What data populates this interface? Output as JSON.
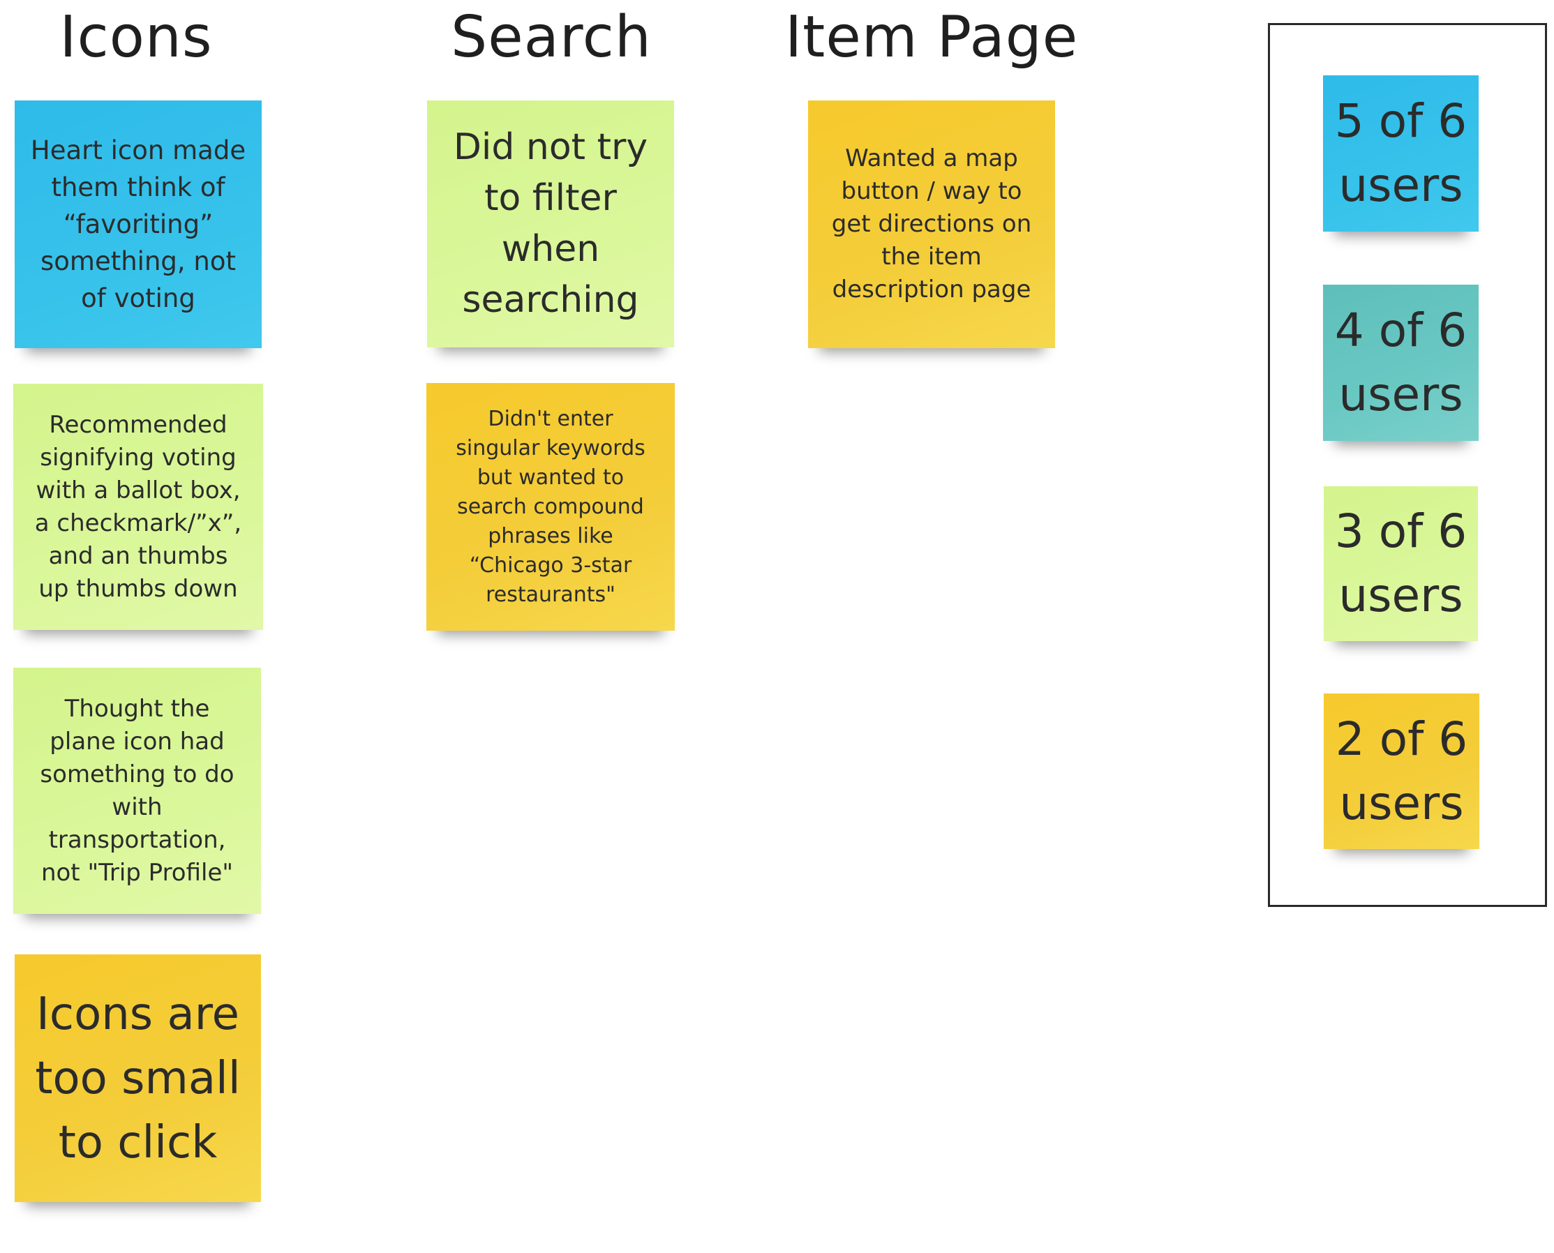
{
  "columns": [
    {
      "title": "Icons"
    },
    {
      "title": "Search"
    },
    {
      "title": "Item Page"
    }
  ],
  "notes": {
    "heart_icon": {
      "text": "Heart icon made them think of “favoriting” something, not of voting",
      "color": "blue"
    },
    "ballot_box": {
      "text": "Recommended signifying voting with a ballot box, a checkmark/”x”, and an thumbs up thumbs down",
      "color": "green"
    },
    "plane_icon": {
      "text": "Thought the plane icon had something to do with transportation, not \"Trip Profile\"",
      "color": "green"
    },
    "icons_small": {
      "text": "Icons are too small to click",
      "color": "yellow"
    },
    "no_filter": {
      "text": "Did not try to filter when searching",
      "color": "green"
    },
    "compound_phrases": {
      "text": "Didn't enter singular keywords but wanted to search compound phrases like “Chicago 3-star restaurants\"",
      "color": "yellow"
    },
    "map_button": {
      "text": "Wanted a map button / way to get directions on the item description page",
      "color": "yellow"
    }
  },
  "legend": [
    {
      "label": "5 of 6 users",
      "color": "#36c2ea"
    },
    {
      "label": "4 of 6 users",
      "color": "#6ac8c3"
    },
    {
      "label": "3 of 6 users",
      "color": "#daf79a"
    },
    {
      "label": "2 of 6 users",
      "color": "#f5cf3b"
    }
  ]
}
